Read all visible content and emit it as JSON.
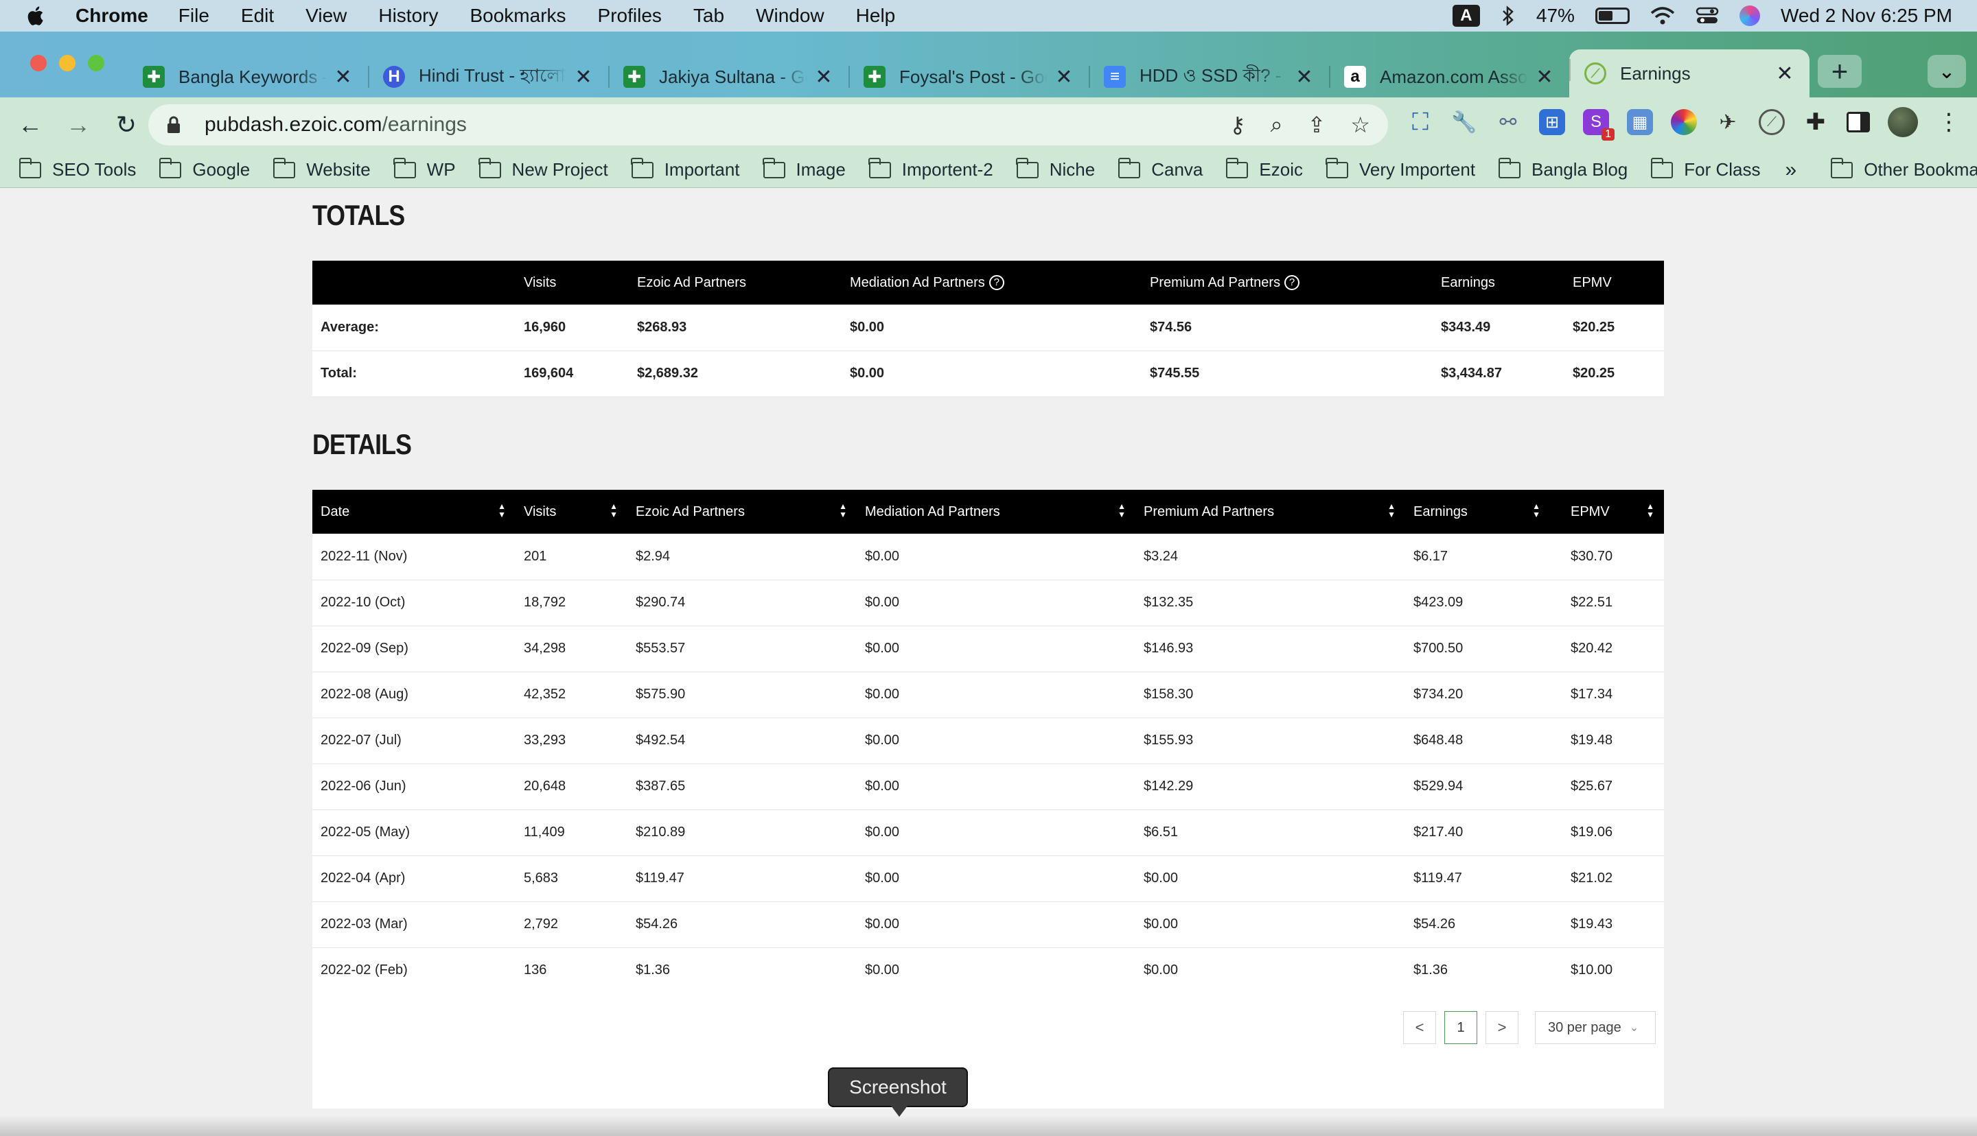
{
  "menubar": {
    "app": "Chrome",
    "menus": [
      "File",
      "Edit",
      "View",
      "History",
      "Bookmarks",
      "Profiles",
      "Tab",
      "Window",
      "Help"
    ],
    "input_source": "A",
    "battery": "47%",
    "datetime": "Wed 2 Nov  6:25 PM"
  },
  "tabs": [
    {
      "title": "Bangla Keywords - G",
      "favicon_color": "#1e8e3e",
      "icon": "sheets-icon"
    },
    {
      "title": "Hindi Trust - হ্যালো, ই",
      "favicon_color": "#3b5bdb",
      "icon": "h-icon"
    },
    {
      "title": "Jakiya Sultana - Goo",
      "favicon_color": "#1e8e3e",
      "icon": "sheets-icon"
    },
    {
      "title": "Foysal's Post - Goog",
      "favicon_color": "#1e8e3e",
      "icon": "sheets-icon"
    },
    {
      "title": "HDD ও SSD কী? - Go",
      "favicon_color": "#4285f4",
      "icon": "docs-icon"
    },
    {
      "title": "Amazon.com Assoc",
      "favicon_color": "#ffffff",
      "icon": "amazon-icon"
    },
    {
      "title": "Earnings",
      "favicon_color": "#7cb342",
      "icon": "ezoic-icon",
      "active": true
    }
  ],
  "address": {
    "host": "pubdash.ezoic.com",
    "path": "/earnings"
  },
  "bookmarks": [
    "SEO Tools",
    "Google",
    "Website",
    "WP",
    "New Project",
    "Important",
    "Image",
    "Importent-2",
    "Niche",
    "Canva",
    "Ezoic",
    "Very Importent",
    "Bangla Blog",
    "For Class"
  ],
  "bookmarks_more": "»",
  "other_bookmarks": "Other Bookmarks",
  "extensions_badge": "1",
  "totals": {
    "title": "TOTALS",
    "headers": [
      "",
      "Visits",
      "Ezoic Ad Partners",
      "Mediation Ad Partners",
      "Premium Ad Partners",
      "Earnings",
      "EPMV"
    ],
    "rows": [
      [
        "Average:",
        "16,960",
        "$268.93",
        "$0.00",
        "$74.56",
        "$343.49",
        "$20.25"
      ],
      [
        "Total:",
        "169,604",
        "$2,689.32",
        "$0.00",
        "$745.55",
        "$3,434.87",
        "$20.25"
      ]
    ]
  },
  "details": {
    "title": "DETAILS",
    "headers": [
      "Date",
      "Visits",
      "Ezoic Ad Partners",
      "Mediation Ad Partners",
      "Premium Ad Partners",
      "Earnings",
      "EPMV"
    ],
    "rows": [
      [
        "2022-11 (Nov)",
        "201",
        "$2.94",
        "$0.00",
        "$3.24",
        "$6.17",
        "$30.70"
      ],
      [
        "2022-10 (Oct)",
        "18,792",
        "$290.74",
        "$0.00",
        "$132.35",
        "$423.09",
        "$22.51"
      ],
      [
        "2022-09 (Sep)",
        "34,298",
        "$553.57",
        "$0.00",
        "$146.93",
        "$700.50",
        "$20.42"
      ],
      [
        "2022-08 (Aug)",
        "42,352",
        "$575.90",
        "$0.00",
        "$158.30",
        "$734.20",
        "$17.34"
      ],
      [
        "2022-07 (Jul)",
        "33,293",
        "$492.54",
        "$0.00",
        "$155.93",
        "$648.48",
        "$19.48"
      ],
      [
        "2022-06 (Jun)",
        "20,648",
        "$387.65",
        "$0.00",
        "$142.29",
        "$529.94",
        "$25.67"
      ],
      [
        "2022-05 (May)",
        "11,409",
        "$210.89",
        "$0.00",
        "$6.51",
        "$217.40",
        "$19.06"
      ],
      [
        "2022-04 (Apr)",
        "5,683",
        "$119.47",
        "$0.00",
        "$0.00",
        "$119.47",
        "$21.02"
      ],
      [
        "2022-03 (Mar)",
        "2,792",
        "$54.26",
        "$0.00",
        "$0.00",
        "$54.26",
        "$19.43"
      ],
      [
        "2022-02 (Feb)",
        "136",
        "$1.36",
        "$0.00",
        "$0.00",
        "$1.36",
        "$10.00"
      ]
    ]
  },
  "pagination": {
    "prev": "<",
    "current": "1",
    "next": ">",
    "per_page": "30 per page"
  },
  "tooltip": "Screenshot"
}
